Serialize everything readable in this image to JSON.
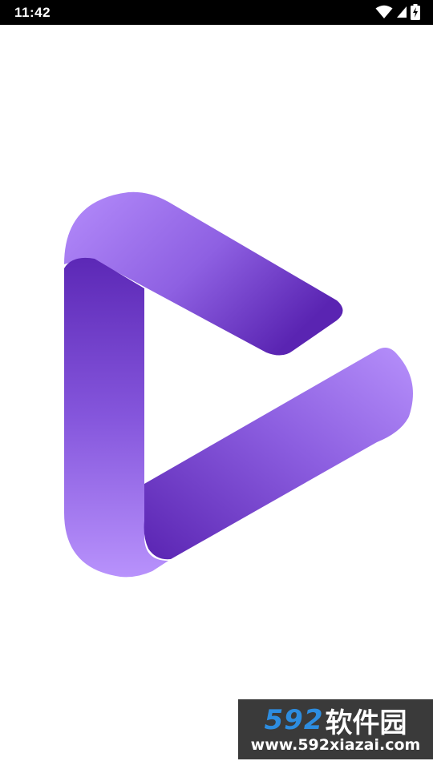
{
  "status_bar": {
    "time": "11:42",
    "icons": [
      "wifi-icon",
      "cellular-signal-icon",
      "battery-charging-icon"
    ]
  },
  "splash": {
    "logo_icon": "play-triangle-logo-icon",
    "colors": {
      "light_purple": "#b48cfb",
      "mid_purple": "#8a5ae0",
      "dark_purple": "#5a26b4"
    }
  },
  "watermark": {
    "brand_number": "592",
    "brand_name": "软件园",
    "url": "www.592xiazai.com"
  }
}
